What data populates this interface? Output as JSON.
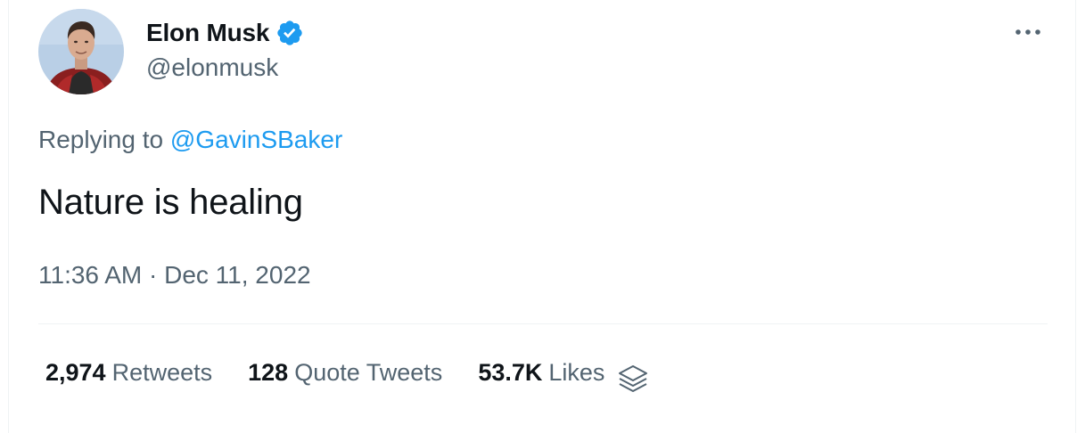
{
  "author": {
    "display_name": "Elon Musk",
    "handle": "@elonmusk",
    "verified": true,
    "verified_icon": "verified-badge-icon",
    "avatar_icon": "profile-photo"
  },
  "more_icon": "more-horizontal-icon",
  "reply": {
    "prefix": "Replying to",
    "mention": "@GavinSBaker"
  },
  "tweet": {
    "text": "Nature is healing",
    "timestamp": "11:36 AM · Dec 11, 2022"
  },
  "stats": {
    "retweets": {
      "count": "2,974",
      "label": "Retweets"
    },
    "quote_tweets": {
      "count": "128",
      "label": "Quote Tweets"
    },
    "likes": {
      "count": "53.7K",
      "label": "Likes"
    },
    "analytics_icon": "layers-icon"
  },
  "colors": {
    "accent": "#1d9bf0",
    "text_primary": "#0f1419",
    "text_secondary": "#536471",
    "divider": "#eff3f4"
  }
}
